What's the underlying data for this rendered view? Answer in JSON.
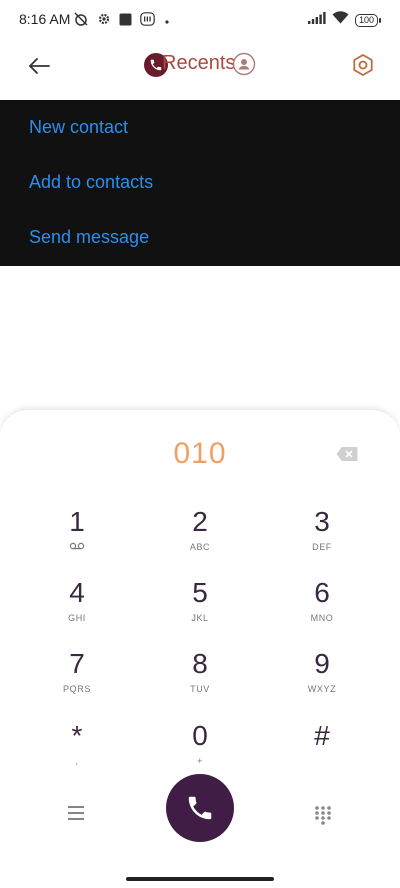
{
  "status_bar": {
    "time": "8:16 AM",
    "battery": "100",
    "icons": [
      "alarm-off-icon",
      "settings-gear-icon",
      "square-icon",
      "mi-icon",
      "dot-icon",
      "signal-icon",
      "wifi-icon",
      "battery-icon"
    ]
  },
  "header": {
    "title": "Recents",
    "icons": [
      "back-arrow-icon",
      "phone-icon",
      "contacts-icon",
      "settings-icon"
    ],
    "colors": {
      "title": "#a94a3e",
      "active_tab": "#6b1a2c"
    }
  },
  "popup_menu": {
    "items": [
      {
        "label": "New contact"
      },
      {
        "label": "Add to contacts"
      },
      {
        "label": "Send message"
      }
    ],
    "colors": {
      "background": "#111111",
      "text": "#2b8ef0"
    }
  },
  "dialpad": {
    "number": "010",
    "keys": [
      {
        "digit": "1",
        "letters": ""
      },
      {
        "digit": "2",
        "letters": "ABC"
      },
      {
        "digit": "3",
        "letters": "DEF"
      },
      {
        "digit": "4",
        "letters": "GHI"
      },
      {
        "digit": "5",
        "letters": "JKL"
      },
      {
        "digit": "6",
        "letters": "MNO"
      },
      {
        "digit": "7",
        "letters": "PQRS"
      },
      {
        "digit": "8",
        "letters": "TUV"
      },
      {
        "digit": "9",
        "letters": "WXYZ"
      },
      {
        "digit": "*",
        "letters": ","
      },
      {
        "digit": "0",
        "letters": "+"
      },
      {
        "digit": "#",
        "letters": ""
      }
    ],
    "icons": [
      "voicemail-icon",
      "backspace-icon",
      "menu-lines-icon",
      "call-icon",
      "dialpad-grid-icon"
    ],
    "colors": {
      "number": "#f0a064",
      "digit": "#3a2740",
      "call_button": "#3f1d44"
    }
  }
}
